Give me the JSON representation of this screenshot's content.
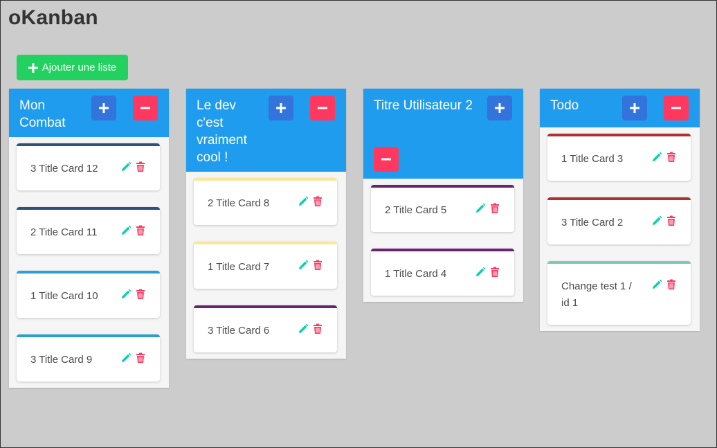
{
  "app": {
    "title": "oKanban"
  },
  "toolbar": {
    "add_list_label": "Ajouter une liste"
  },
  "colors": {
    "background": "#cccccc",
    "list_header": "#209cee",
    "add_button": "#3273dc",
    "delete_button": "#ff3860",
    "add_list_button": "#23d160",
    "edit_icon": "#00d1b2",
    "trash_icon": "#ff3860"
  },
  "lists": [
    {
      "title": "Mon Combat",
      "cards": [
        {
          "title": "3 Title Card 12",
          "color": "#2c5282"
        },
        {
          "title": "2 Title Card 11",
          "color": "#2c5282"
        },
        {
          "title": "1 Title Card 10",
          "color": "#2a9fd6"
        },
        {
          "title": "3 Title Card 9",
          "color": "#2a9fd6"
        }
      ]
    },
    {
      "title": "Le dev c'est vraiment cool !",
      "cards": [
        {
          "title": "2 Title Card 8",
          "color": "#f9e79f"
        },
        {
          "title": "1 Title Card 7",
          "color": "#f9e79f"
        },
        {
          "title": "3 Title Card 6",
          "color": "#6b2270"
        }
      ]
    },
    {
      "title": "Titre Utilisateur 2",
      "cards": [
        {
          "title": "2 Title Card 5",
          "color": "#6b2270"
        },
        {
          "title": "1 Title Card 4",
          "color": "#6b2270"
        }
      ]
    },
    {
      "title": "Todo",
      "cards": [
        {
          "title": "1 Title Card 3",
          "color": "#b03030"
        },
        {
          "title": "3 Title Card 2",
          "color": "#b03030"
        },
        {
          "title": "Change test 1 / id 1",
          "color": "#7ec8b8"
        }
      ]
    }
  ]
}
